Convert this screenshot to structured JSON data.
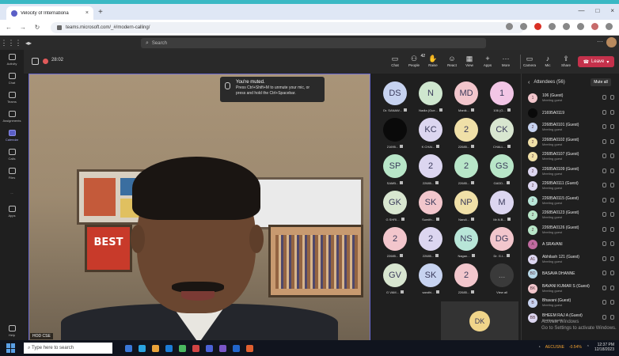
{
  "browser": {
    "tab_title": "Velocity of Internationa",
    "tab_close": "×",
    "new_tab": "+",
    "url": "teams.microsoft.com/_#/modern-calling/",
    "window_controls": [
      "—",
      "□",
      "×"
    ]
  },
  "teams": {
    "search_placeholder": "Search",
    "rail": [
      {
        "label": "Activity",
        "icon": "bell-icon"
      },
      {
        "label": "Chat",
        "icon": "chat-icon"
      },
      {
        "label": "Teams",
        "icon": "teams-icon"
      },
      {
        "label": "Assignments",
        "icon": "assignments-icon"
      },
      {
        "label": "Calendar",
        "icon": "calendar-icon"
      },
      {
        "label": "Calls",
        "icon": "calls-icon"
      },
      {
        "label": "Files",
        "icon": "files-icon"
      },
      {
        "label": "...",
        "icon": "more-icon"
      },
      {
        "label": "Apps",
        "icon": "apps-icon"
      }
    ],
    "rail_help": "Help"
  },
  "meeting": {
    "timer": "28:02",
    "toolbar": {
      "chat": "Chat",
      "people": "People",
      "people_count": "42",
      "raise": "Raise",
      "react": "React",
      "view": "View",
      "apps": "Apps",
      "more": "More",
      "camera": "Camera",
      "mic": "Mic",
      "share": "Share",
      "leave": "Leave"
    },
    "muted_title": "You're muted.",
    "muted_body": "Press Ctrl+Shift+M to unmute your mic, or press and hold the Ctrl+Spacebar.",
    "video_name": "HOD CSE",
    "wall_poster_text": "BEST",
    "wall_poster_sub": "THE WEEK"
  },
  "gallery": {
    "tiles": [
      {
        "initials": "DS",
        "label": "Dr. SANAW...",
        "color": "#c7d3f0"
      },
      {
        "initials": "N",
        "label": "Nadia (Gue...",
        "color": "#cfe7cf"
      },
      {
        "initials": "MD",
        "label": "Manik...",
        "color": "#f2c6cc"
      },
      {
        "initials": "1",
        "label": "106 (G...",
        "color": "#f2c6e6"
      },
      {
        "initials": "",
        "label": "21695...",
        "color": "#0a0a0a"
      },
      {
        "initials": "KC",
        "label": "K CHAI...",
        "color": "#dcd6f0"
      },
      {
        "initials": "2",
        "label": "22685...",
        "color": "#f0e0a8"
      },
      {
        "initials": "CK",
        "label": "CHALL...",
        "color": "#d8e6d0"
      },
      {
        "initials": "SP",
        "label": "SAMB...",
        "color": "#b8e6c8"
      },
      {
        "initials": "2",
        "label": "22685...",
        "color": "#dcd6f0"
      },
      {
        "initials": "2",
        "label": "22685...",
        "color": "#b8e6c8"
      },
      {
        "initials": "GS",
        "label": "GADD...",
        "color": "#b8e6c8"
      },
      {
        "initials": "GK",
        "label": "G SHRI...",
        "color": "#d8e6d0"
      },
      {
        "initials": "SK",
        "label": "Sumith...",
        "color": "#f2c6cc"
      },
      {
        "initials": "NP",
        "label": "Nandi...",
        "color": "#f0e0a8"
      },
      {
        "initials": "M",
        "label": "Mr.N.B...",
        "color": "#dcd6f0"
      },
      {
        "initials": "2",
        "label": "22685...",
        "color": "#f2c6cc"
      },
      {
        "initials": "2",
        "label": "22685...",
        "color": "#dcd6f0"
      },
      {
        "initials": "NS",
        "label": "Nagan...",
        "color": "#b8e6d8"
      },
      {
        "initials": "DG",
        "label": "Dr. G.I...",
        "color": "#f2c6cc"
      },
      {
        "initials": "GV",
        "label": "G VAM...",
        "color": "#d8e6d0"
      },
      {
        "initials": "SK",
        "label": "sandhi...",
        "color": "#c7d3f0"
      },
      {
        "initials": "2",
        "label": "22685...",
        "color": "#f2c6cc"
      },
      {
        "initials": "...",
        "label": "View all",
        "color": "#3a3a3a"
      }
    ],
    "self_initials": "DK"
  },
  "attendees": {
    "title": "Attendees",
    "count": "(56)",
    "mute_all": "Mute all",
    "list": [
      {
        "initials": "1",
        "name": "106 (Guest)",
        "role": "Meeting guest",
        "color": "#f2c6cc"
      },
      {
        "initials": "",
        "name": "21695A0119",
        "role": "",
        "color": "#0a0a0a"
      },
      {
        "initials": "2",
        "name": "22685A0101 (Guest)",
        "role": "Meeting guest",
        "color": "#c7d3f0"
      },
      {
        "initials": "2",
        "name": "22685A0102 (Guest)",
        "role": "Meeting guest",
        "color": "#f0e0a8"
      },
      {
        "initials": "2",
        "name": "22685A0107 (Guest)",
        "role": "Meeting guest",
        "color": "#f0e0a8"
      },
      {
        "initials": "2",
        "name": "22685A0109 (Guest)",
        "role": "Meeting guest",
        "color": "#dcd6f0"
      },
      {
        "initials": "2",
        "name": "22685A0111 (Guest)",
        "role": "Meeting guest",
        "color": "#dcd6f0"
      },
      {
        "initials": "2",
        "name": "22685A0115 (Guest)",
        "role": "Meeting guest",
        "color": "#b8e6d8"
      },
      {
        "initials": "2",
        "name": "22685A0123 (Guest)",
        "role": "Meeting guest",
        "color": "#b8e6c8"
      },
      {
        "initials": "2",
        "name": "22685A0126 (Guest)",
        "role": "Meeting guest",
        "color": "#b8e6c8"
      },
      {
        "initials": "A",
        "name": "A SRAVANI",
        "role": "",
        "color": "#c06aa0"
      },
      {
        "initials": "A1",
        "name": "Abhilash 121 (Guest)",
        "role": "Meeting guest",
        "color": "#dcd6f0"
      },
      {
        "initials": "BD",
        "name": "BASAVA DHANNE",
        "role": "",
        "color": "#b8d8e8"
      },
      {
        "initials": "BK",
        "name": "BAVANI KUMAR S (Guest)",
        "role": "Meeting guest",
        "color": "#f2c6cc"
      },
      {
        "initials": "B",
        "name": "Bhavani (Guest)",
        "role": "Meeting guest",
        "color": "#c7d3f0"
      },
      {
        "initials": "BB",
        "name": "BHEEM RAJ A (Guest)",
        "role": "Meeting guest",
        "color": "#dcd6f0"
      }
    ],
    "activate_line1": "Activate Windows",
    "activate_line2": "Go to Settings to activate Windows."
  },
  "taskbar": {
    "search_placeholder": "Type here to search",
    "stock": "AECUSNE",
    "stock_change": "-0.54%",
    "time": "12:37 PM",
    "date": "12/18/2023",
    "app_colors": [
      "#3a78d8",
      "#2aa3e0",
      "#e8a23a",
      "#1c7cd6",
      "#4ab860",
      "#d04444",
      "#4a62d8",
      "#7a56c8",
      "#2266cc",
      "#e06030"
    ]
  }
}
